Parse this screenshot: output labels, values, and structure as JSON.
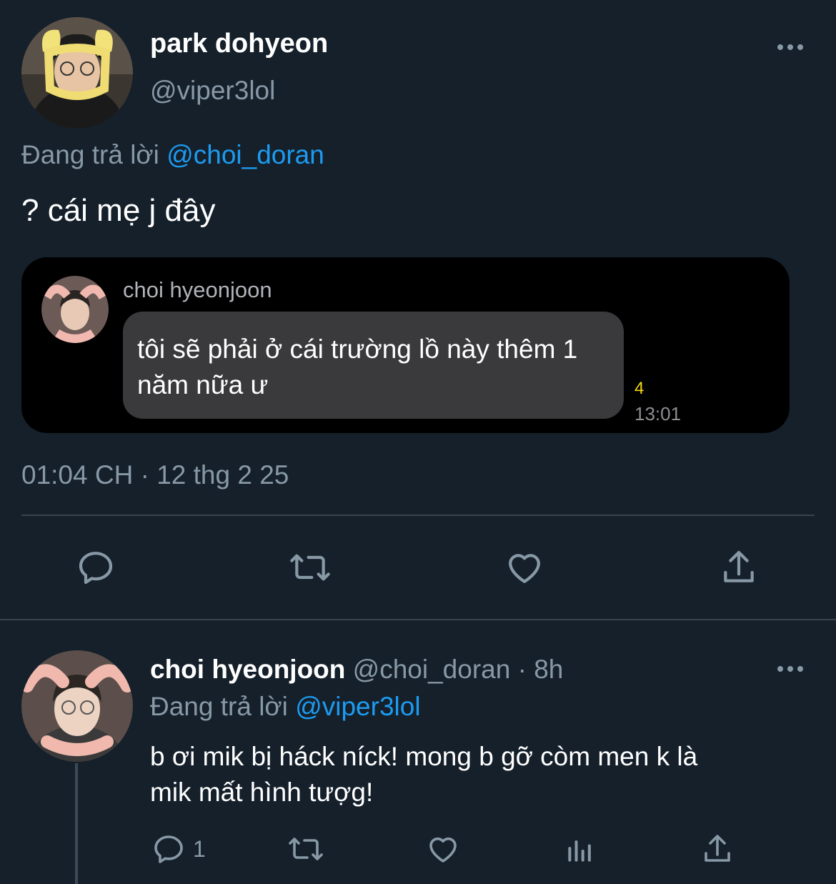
{
  "tweet": {
    "author_name": "park dohyeon",
    "author_handle": "@viper3lol",
    "reply_prefix": "Đang trả lời",
    "reply_to": "@choi_doran",
    "text": "? cái mẹ j đây",
    "timestamp": "01:04 CH · 12 thg 2 25",
    "more_icon": "more-horizontal-icon",
    "embedded_chat": {
      "sender_name": "choi hyeonjoon",
      "message": "tôi sẽ phải ở cái trường lồ này thêm 1 năm nữa ư",
      "unread_count": "4",
      "time": "13:01",
      "count_color": "#f5d90a"
    },
    "actions": [
      "reply-icon",
      "retweet-icon",
      "like-icon",
      "share-icon"
    ]
  },
  "reply": {
    "author_name": "choi hyeonjoon",
    "author_handle": "@choi_doran",
    "age": "· 8h",
    "reply_prefix": "Đang trả lời",
    "reply_to": "@viper3lol",
    "text_line1": "b ơi mik bị háck níck! mong b gỡ còm men k là",
    "text_line2": "mik mất hình tượg!",
    "reply_count": "1",
    "actions": [
      "reply-icon",
      "retweet-icon",
      "like-icon",
      "analytics-icon",
      "share-icon"
    ]
  },
  "colors": {
    "background": "#15202b",
    "accent": "#1d9bf0",
    "muted": "#8899a6",
    "divider": "#38444d",
    "chat_bubble": "#3a3a3c",
    "chat_card": "#000000"
  }
}
